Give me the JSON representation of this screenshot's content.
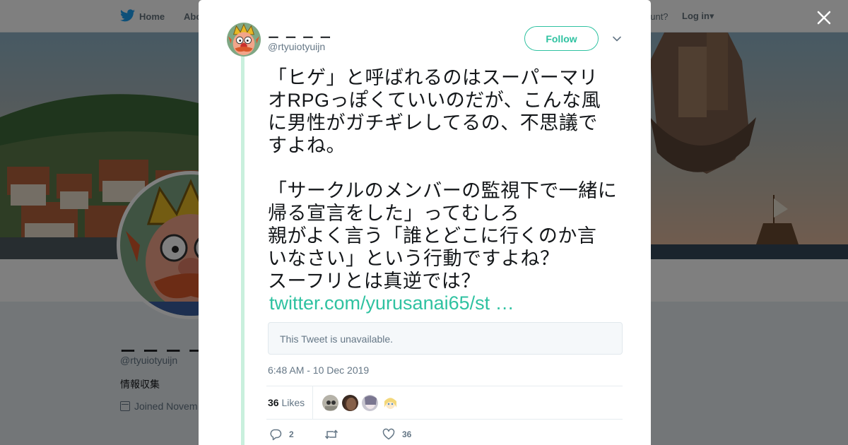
{
  "topbar": {
    "home_label": "Home",
    "about_label": "Abo",
    "have_account": "ccount?",
    "login_label": "Log in"
  },
  "profile": {
    "display_name": "ー ー ー ー",
    "handle": "@rtyuiotyuijn",
    "bio": "情報収集",
    "joined": "Joined Novem"
  },
  "tweet": {
    "display_name": "ー ー ー ー",
    "handle": "@rtyuiotyuijn",
    "follow_label": "Follow",
    "paragraph_1": "「ヒゲ」と呼ばれるのはスーパーマリ\nオRPGっぽくていいのだが、こんな風\nに男性がガチギレしてるの、不思議で\nすよね。",
    "paragraph_2": "「サークルのメンバーの監視下で一緒に\n帰る宣言をした」ってむしろ\n親がよく言う「誰とどこに行くのか言\nいなさい」という行動ですよね？\nスーフリとは真逆では？",
    "link_text": "twitter.com/yurusanai65/st …",
    "quote_unavailable": "This Tweet is unavailable.",
    "timestamp": "6:48 AM - 10 Dec 2019",
    "likes_count": "36",
    "likes_label": "Likes",
    "reply_count": "2",
    "retweet_count": "",
    "like_count": "36"
  },
  "colors": {
    "accent": "#2fc2a1",
    "thread_line": "#c9f0dd",
    "muted_text": "#657786"
  },
  "icons": {
    "close": "close-icon",
    "caret": "chevron-down-icon",
    "reply": "reply-icon",
    "retweet": "retweet-icon",
    "like": "heart-icon",
    "bird": "twitter-bird-icon",
    "calendar": "calendar-icon"
  }
}
